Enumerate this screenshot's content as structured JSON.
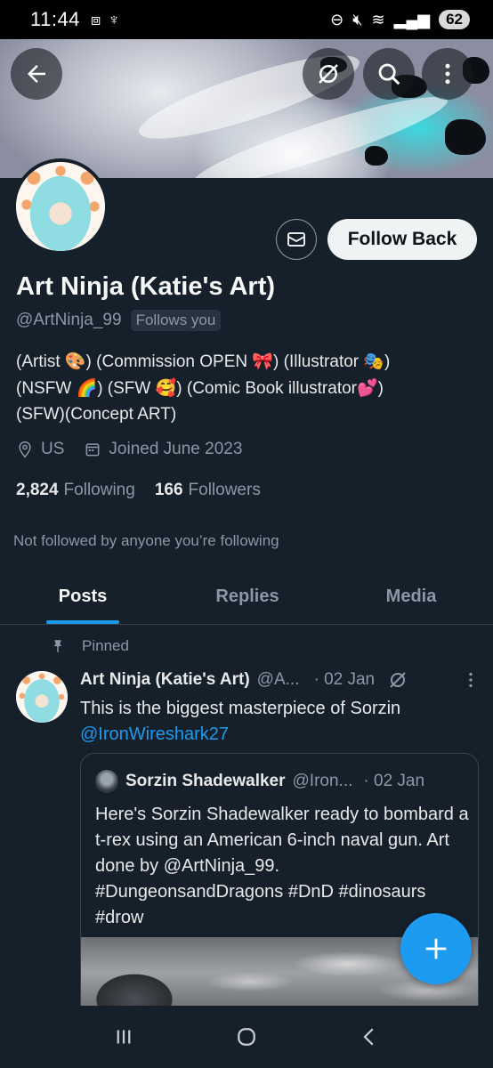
{
  "status_bar": {
    "time": "11:44",
    "battery": "62"
  },
  "profile": {
    "name": "Art Ninja (Katie's Art)",
    "handle": "@ArtNinja_99",
    "follows_you": "Follows you",
    "follow_back_label": "Follow Back",
    "bio": "(Artist 🎨) (Commission OPEN 🎀)  (Illustrator 🎭)\n(NSFW 🌈) (SFW 🥰) (Comic Book illustrator💕)\n(SFW)(Concept ART)",
    "location": "US",
    "joined": "Joined June 2023",
    "following_count": "2,824",
    "following_label": "Following",
    "followers_count": "166",
    "followers_label": "Followers",
    "not_followed": "Not followed by anyone you’re following"
  },
  "tabs": [
    {
      "label": "Posts",
      "active": true
    },
    {
      "label": "Replies",
      "active": false
    },
    {
      "label": "Media",
      "active": false
    }
  ],
  "pinned_label": "Pinned",
  "tweet": {
    "name": "Art Ninja (Katie's Art)",
    "handle": "@A...",
    "date": "· 02 Jan",
    "text": "This is the biggest masterpiece of Sorzin",
    "mention": "@IronWireshark27"
  },
  "quote": {
    "name": "Sorzin Shadewalker",
    "handle": "@Iron...",
    "date": "· 02 Jan",
    "text": "Here's Sorzin Shadewalker ready to bombard a t-rex using an American 6-inch naval gun. Art done by @ArtNinja_99. #DungeonsandDragons #DnD #dinosaurs #drow"
  },
  "colors": {
    "background": "#15202b",
    "accent": "#1d9bf0",
    "secondary_text": "#8b98a5"
  }
}
